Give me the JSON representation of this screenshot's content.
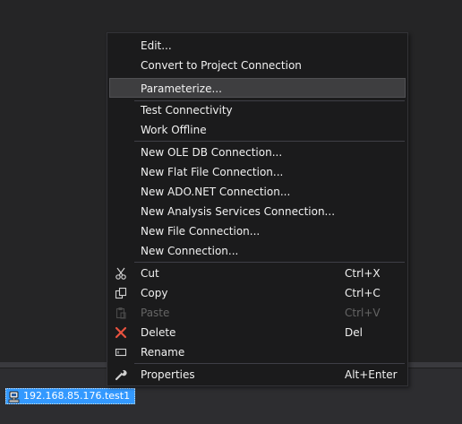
{
  "context_menu": {
    "items": [
      {
        "label": "Edit...",
        "shortcut": "",
        "icon": ""
      },
      {
        "label": "Convert to Project Connection",
        "shortcut": "",
        "icon": ""
      },
      {
        "label": "Parameterize...",
        "shortcut": "",
        "icon": ""
      },
      {
        "label": "Test Connectivity",
        "shortcut": "",
        "icon": ""
      },
      {
        "label": "Work Offline",
        "shortcut": "",
        "icon": ""
      },
      {
        "label": "New OLE DB Connection...",
        "shortcut": "",
        "icon": ""
      },
      {
        "label": "New Flat File Connection...",
        "shortcut": "",
        "icon": ""
      },
      {
        "label": "New ADO.NET Connection...",
        "shortcut": "",
        "icon": ""
      },
      {
        "label": "New Analysis Services Connection...",
        "shortcut": "",
        "icon": ""
      },
      {
        "label": "New File Connection...",
        "shortcut": "",
        "icon": ""
      },
      {
        "label": "New Connection...",
        "shortcut": "",
        "icon": ""
      },
      {
        "label": "Cut",
        "shortcut": "Ctrl+X",
        "icon": "scissors-icon"
      },
      {
        "label": "Copy",
        "shortcut": "Ctrl+C",
        "icon": "copy-icon"
      },
      {
        "label": "Paste",
        "shortcut": "Ctrl+V",
        "icon": "paste-icon"
      },
      {
        "label": "Delete",
        "shortcut": "Del",
        "icon": "delete-x-icon"
      },
      {
        "label": "Rename",
        "shortcut": "",
        "icon": "rename-icon"
      },
      {
        "label": "Properties",
        "shortcut": "Alt+Enter",
        "icon": "wrench-icon"
      }
    ],
    "highlighted_item": "Parameterize...",
    "disabled_items": [
      "Paste"
    ]
  },
  "connection_manager": {
    "label": "192.168.85.176.test1",
    "icon": "database-connection-icon"
  },
  "colors": {
    "background": "#252526",
    "menu_background": "#1b1b1c",
    "menu_text": "#f1f1f1",
    "disabled_text": "#656565",
    "highlight": "#3e3e40",
    "selection": "#3399ff",
    "delete_icon": "#e8523f"
  }
}
